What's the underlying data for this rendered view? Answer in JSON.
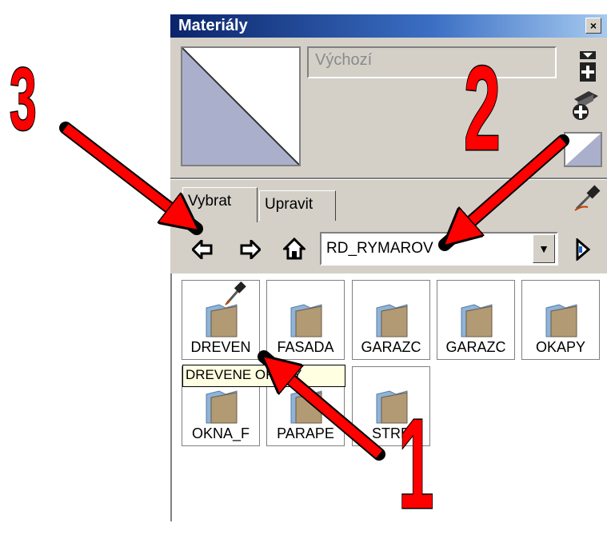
{
  "window": {
    "title": "Materiály",
    "close_label": "×"
  },
  "material": {
    "name_placeholder": "Výchozí"
  },
  "tabs": [
    {
      "label": "Vybrat"
    },
    {
      "label": "Upravit"
    }
  ],
  "library": {
    "selected": "RD_RYMAROV"
  },
  "tiles": [
    {
      "label": "DREVEN"
    },
    {
      "label": "FASADA"
    },
    {
      "label": "GARAZC"
    },
    {
      "label": "GARAZC"
    },
    {
      "label": "OKAPY"
    },
    {
      "label": "OKNA_F"
    },
    {
      "label": "PARAPE"
    },
    {
      "label": "STRE"
    }
  ],
  "tooltip": {
    "text": "DREVENE OKAPY"
  },
  "annotations": {
    "n1": "1",
    "n2": "2",
    "n3": "3"
  },
  "colors": {
    "titlebar": "#0a246a",
    "panel": "#d4d0c8",
    "swatch": "#aab0cc",
    "arrow": "#ff0000",
    "folder": "#b29a74"
  },
  "icons": [
    "close-icon",
    "create-material-icon",
    "add-to-model-icon",
    "sample-paint-icon",
    "back-arrow-icon",
    "forward-arrow-icon",
    "home-icon",
    "dropdown-arrow-icon",
    "details-arrow-icon",
    "folder-icon"
  ]
}
